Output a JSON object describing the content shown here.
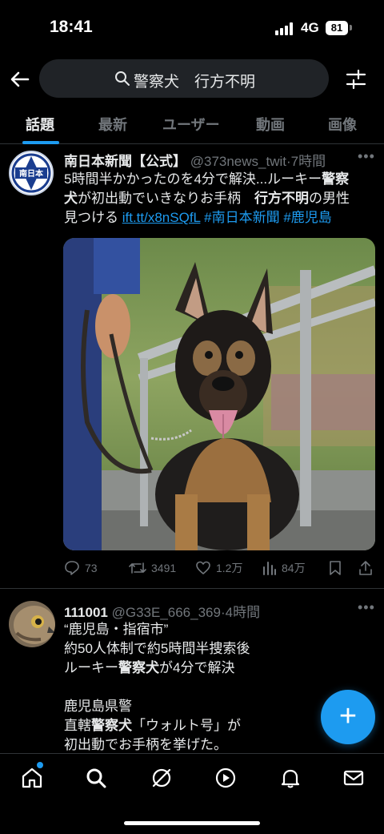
{
  "status": {
    "time": "18:41",
    "network": "4G",
    "battery": "81"
  },
  "search": {
    "query": "警察犬　行方不明"
  },
  "tabs": [
    {
      "label": "話題"
    },
    {
      "label": "最新"
    },
    {
      "label": "ユーザー"
    },
    {
      "label": "動画"
    },
    {
      "label": "画像"
    }
  ],
  "tweet1": {
    "name": "南日本新聞【公式】",
    "handle": "@373news_twit",
    "time": "·7時間",
    "avatar_text": "南日本",
    "line1": "5時間半かかったのを4分で解決...ルーキー",
    "line1_bold": "警察",
    "line2_bold": "犬",
    "line2": "が初出動でいきなりお手柄　",
    "line2_bold2": "行方不明",
    "line2_end": "の男性",
    "line3": "見つける ",
    "link": "ift.tt/x8nSQfL",
    "hashtag1": "#南日本新聞",
    "hashtag2": "#鹿児島",
    "replies": "73",
    "retweets": "3491",
    "likes": "1.2万",
    "views": "84万"
  },
  "tweet2": {
    "name": "111001",
    "handle": "@G33E_666_369",
    "time": "·4時間",
    "line1": "“鹿児島・指宿市”",
    "line2": "約50人体制で約5時間半捜索後",
    "line3a": "ルーキー",
    "line3b": "警察犬",
    "line3c": "が4分で解決",
    "line4": "鹿児島県警",
    "line5a": "直轄",
    "line5b": "警察犬",
    "line5c": "「ウォルト号」が",
    "line6": "初出動でお手柄を挙げた。"
  },
  "fab": {
    "label": "+"
  },
  "colors": {
    "accent": "#1d9bf0",
    "background": "#000000",
    "muted": "#71767b"
  }
}
